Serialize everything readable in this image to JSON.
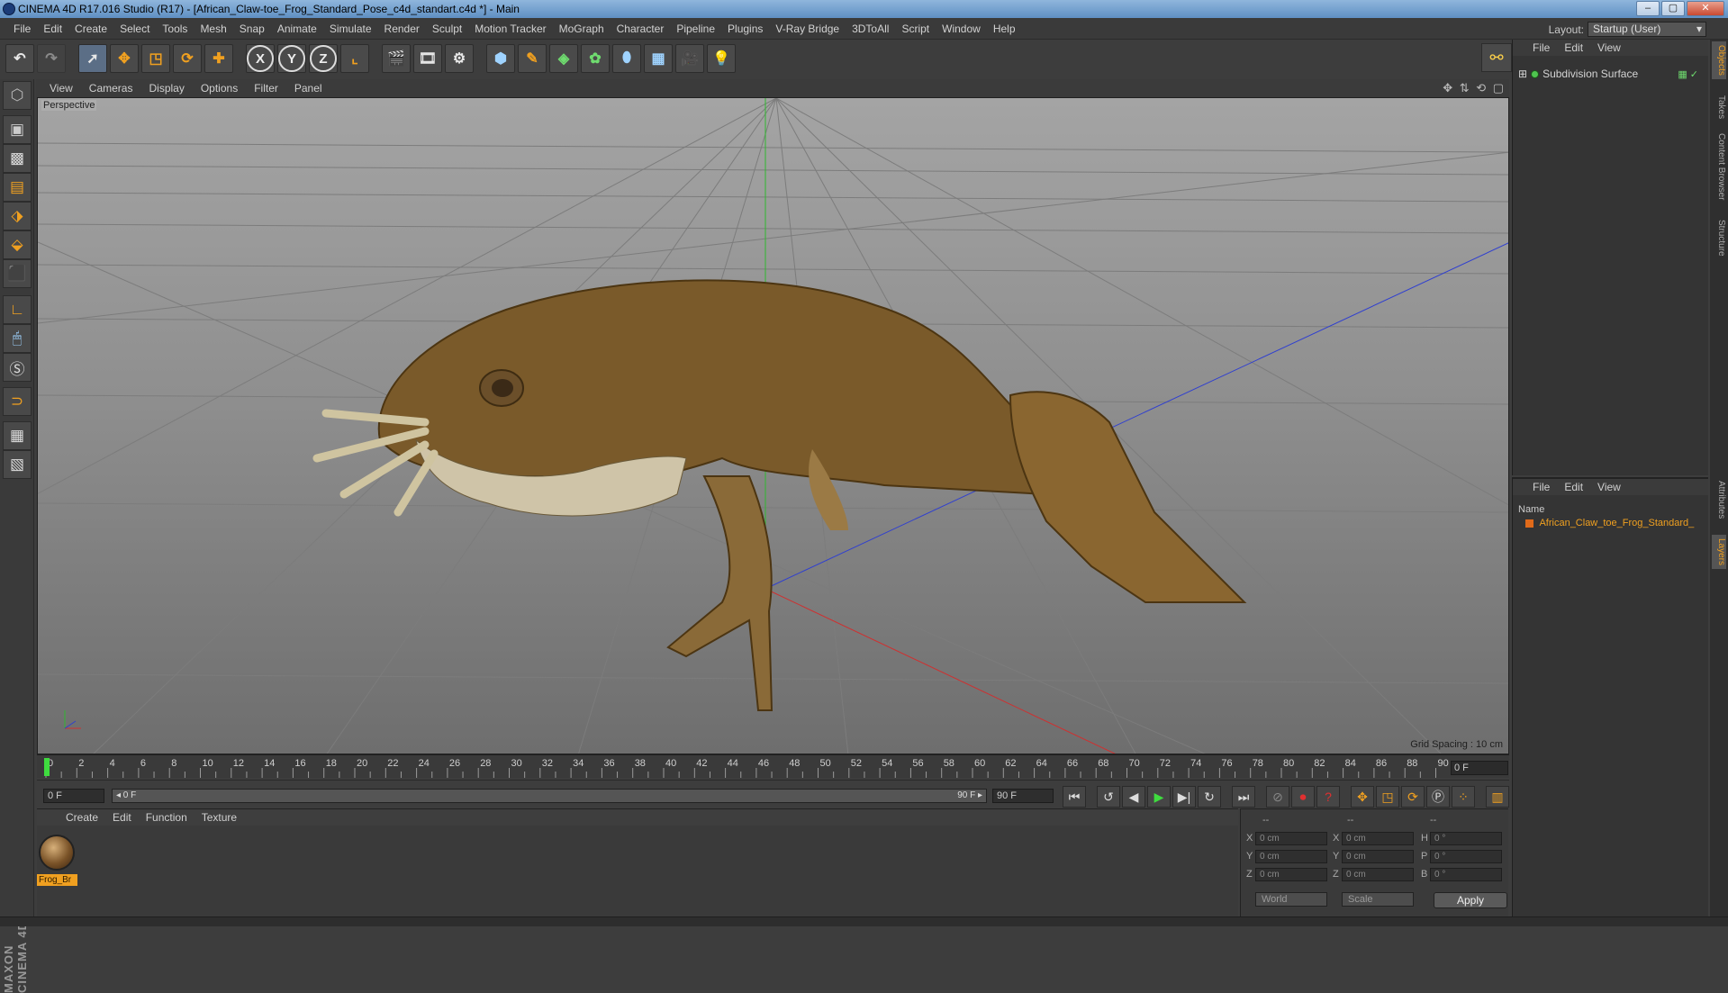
{
  "window": {
    "title": "CINEMA 4D R17.016 Studio (R17) - [African_Claw-toe_Frog_Standard_Pose_c4d_standart.c4d *] - Main",
    "buttons": [
      "–",
      "▢",
      "✕"
    ]
  },
  "menu": [
    "File",
    "Edit",
    "Create",
    "Select",
    "Tools",
    "Mesh",
    "Snap",
    "Animate",
    "Simulate",
    "Render",
    "Sculpt",
    "Motion Tracker",
    "MoGraph",
    "Character",
    "Pipeline",
    "Plugins",
    "V-Ray Bridge",
    "3DToAll",
    "Script",
    "Window",
    "Help"
  ],
  "layout": {
    "label": "Layout:",
    "value": "Startup (User)"
  },
  "viewport": {
    "menu": [
      "View",
      "Cameras",
      "Display",
      "Options",
      "Filter",
      "Panel"
    ],
    "label": "Perspective",
    "grid_spacing": "Grid Spacing : 10 cm"
  },
  "timeline": {
    "ticks": [
      "0",
      "2",
      "4",
      "6",
      "8",
      "10",
      "12",
      "14",
      "16",
      "18",
      "20",
      "22",
      "24",
      "26",
      "28",
      "30",
      "32",
      "34",
      "36",
      "38",
      "40",
      "42",
      "44",
      "46",
      "48",
      "50",
      "52",
      "54",
      "56",
      "58",
      "60",
      "62",
      "64",
      "66",
      "68",
      "70",
      "72",
      "74",
      "76",
      "78",
      "80",
      "82",
      "84",
      "86",
      "88",
      "90"
    ],
    "current_frame": "0 F",
    "start_field": "0 F",
    "slider_start": "◂ 0 F",
    "slider_end": "90 F ▸",
    "end_field": "90 F"
  },
  "material_panel": {
    "menu": [
      "Create",
      "Edit",
      "Function",
      "Texture"
    ],
    "material_name": "Frog_Br"
  },
  "coord_panel": {
    "headers": [
      "--",
      "--",
      "--"
    ],
    "rows": [
      {
        "a": "X",
        "av": "0 cm",
        "b": "X",
        "bv": "0 cm",
        "c": "H",
        "cv": "0 °"
      },
      {
        "a": "Y",
        "av": "0 cm",
        "b": "Y",
        "bv": "0 cm",
        "c": "P",
        "cv": "0 °"
      },
      {
        "a": "Z",
        "av": "0 cm",
        "b": "Z",
        "bv": "0 cm",
        "c": "B",
        "cv": "0 °"
      }
    ],
    "mode1": "World",
    "mode2": "Scale",
    "apply": "Apply"
  },
  "object_panel": {
    "menu": [
      "File",
      "Edit",
      "View"
    ],
    "object": "Subdivision Surface"
  },
  "layer_panel": {
    "menu": [
      "File",
      "Edit",
      "View"
    ],
    "header": "Name",
    "item": "African_Claw_toe_Frog_Standard_"
  },
  "side_tabs": [
    "Objects",
    "Takes",
    "Content Browser",
    "Structure",
    "Attributes",
    "Layers"
  ],
  "logo": "MAXON CINEMA 4D",
  "colors": {
    "accent": "#f0a020",
    "panel": "#3a3a3a",
    "viewport_bg": "#9a9a9a"
  }
}
